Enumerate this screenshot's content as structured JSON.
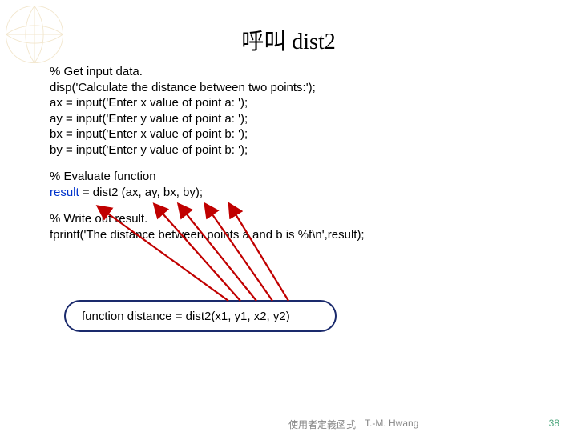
{
  "title_cjk": "呼叫",
  "title_fn": "dist2",
  "code": {
    "c1": "% Get input data.",
    "c2": "disp('Calculate the distance between two points:');",
    "c3": "ax = input('Enter x value of point a:   ');",
    "c4": "ay = input('Enter y value of point a:   ');",
    "c5": "bx = input('Enter x value of point b:   ');",
    "c6": "by = input('Enter y value of point b:   ');",
    "c7": "% Evaluate function",
    "c8a": "result",
    "c8b": " = dist2 (ax, ay, bx, by);",
    "c9": "% Write out result.",
    "c10": "fprintf('The distance between points a and b is %f\\n',result);"
  },
  "fn_decl": "function distance = dist2(x1, y1, x2, y2)",
  "footer": {
    "src": "使用者定義函式",
    "author": "T.-M. Hwang",
    "page": "38"
  }
}
